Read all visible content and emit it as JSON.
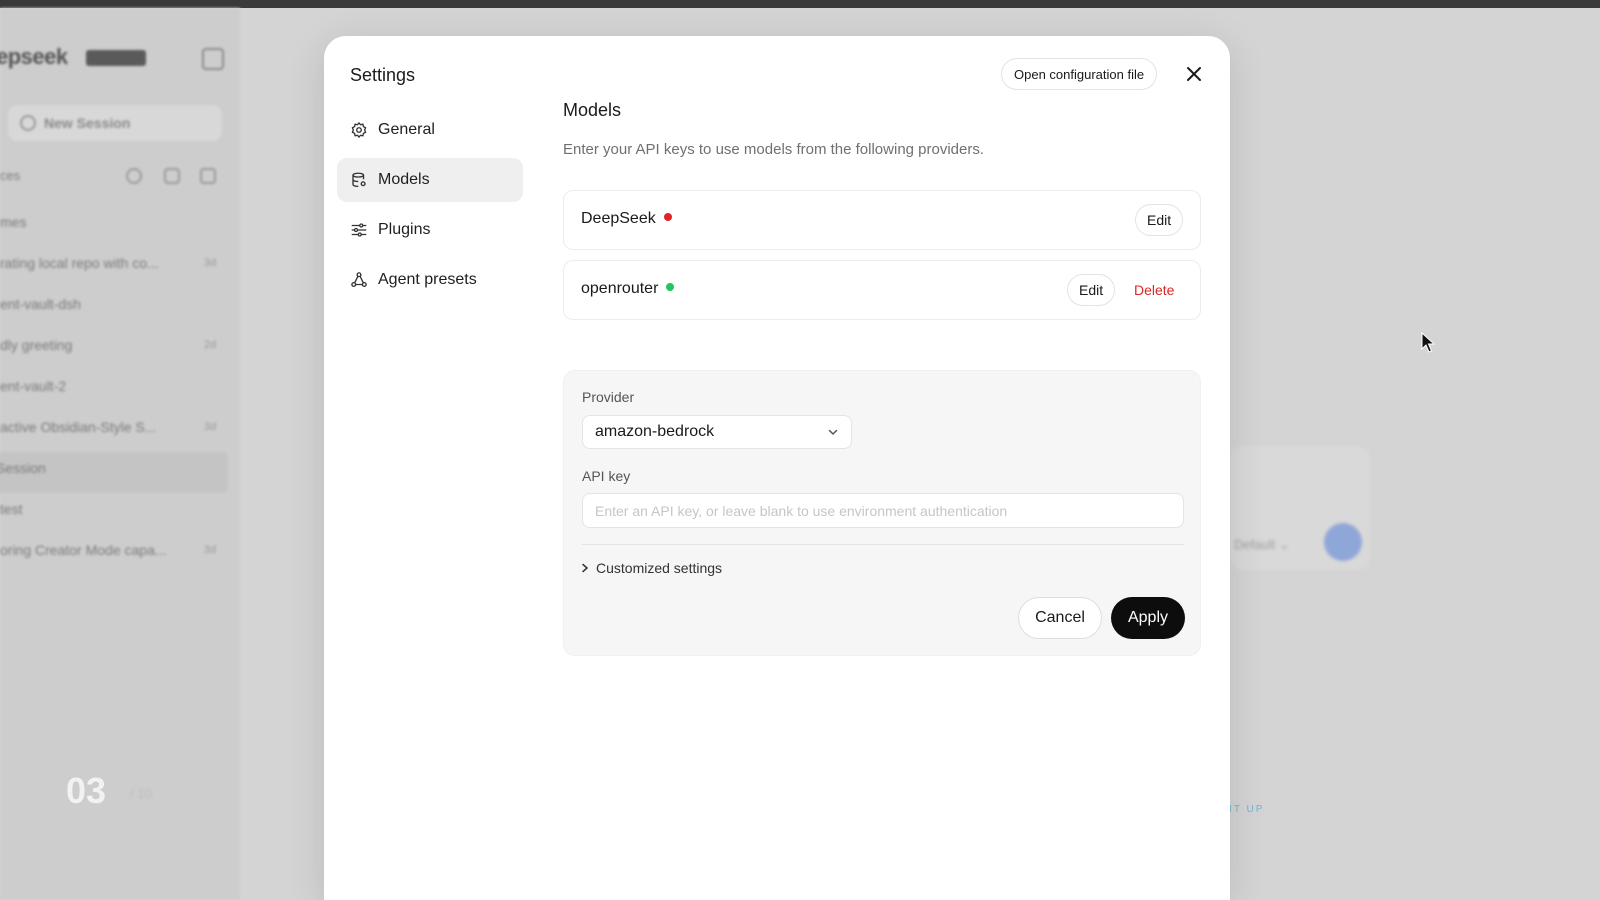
{
  "background": {
    "brand": "epseek",
    "new_session": "New Session",
    "section_label": "ces",
    "sessions": [
      {
        "title": "mes",
        "count": ""
      },
      {
        "title": "rating local repo with co...",
        "count": "3d"
      },
      {
        "title": "ent-vault-dsh",
        "count": ""
      },
      {
        "title": "dly greeting",
        "count": "2d"
      },
      {
        "title": "ent-vault-2",
        "count": ""
      },
      {
        "title": "active Obsidian-Style S...",
        "count": "3d"
      },
      {
        "title": "Session",
        "count": ""
      },
      {
        "title": "test",
        "count": ""
      },
      {
        "title": "oring Creator Mode capa...",
        "count": "3d"
      }
    ],
    "slide_counter": "03",
    "slide_total": "/ 10",
    "default_label": "Default",
    "level_tag": "LEVEL 1 · SET IT UP"
  },
  "modal": {
    "title": "Settings",
    "open_config_label": "Open configuration file",
    "nav": [
      {
        "label": "General",
        "icon": "gear-icon"
      },
      {
        "label": "Models",
        "icon": "database-icon"
      },
      {
        "label": "Plugins",
        "icon": "sliders-icon"
      },
      {
        "label": "Agent presets",
        "icon": "agent-icon"
      }
    ],
    "active_nav": "Models"
  },
  "models": {
    "title": "Models",
    "description": "Enter your API keys to use models from the following providers.",
    "providers": [
      {
        "name": "DeepSeek",
        "status_color": "#dc2626",
        "edit_label": "Edit"
      },
      {
        "name": "openrouter",
        "status_color": "#22c55e",
        "edit_label": "Edit",
        "delete_label": "Delete"
      }
    ],
    "delete_color": "#dc2626",
    "form": {
      "provider_label": "Provider",
      "provider_value": "amazon-bedrock",
      "api_key_label": "API key",
      "api_key_value": "",
      "api_key_placeholder": "Enter an API key, or leave blank to use environment authentication",
      "customized_label": "Customized settings",
      "cancel_label": "Cancel",
      "apply_label": "Apply"
    }
  }
}
